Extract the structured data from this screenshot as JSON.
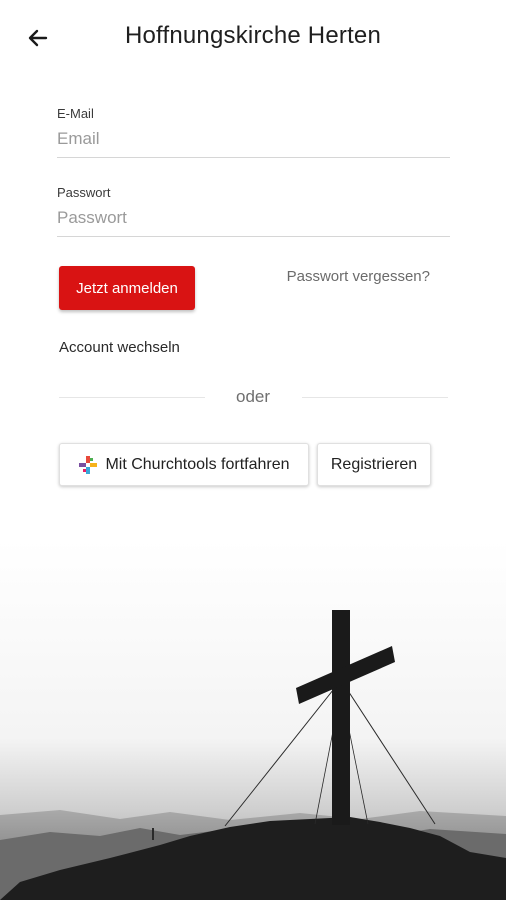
{
  "header": {
    "title": "Hoffnungskirche Herten",
    "back_icon": "arrow-left-icon"
  },
  "form": {
    "email": {
      "label": "E-Mail",
      "placeholder": "Email",
      "value": ""
    },
    "password": {
      "label": "Passwort",
      "placeholder": "Passwort",
      "value": ""
    }
  },
  "actions": {
    "login_label": "Jetzt anmelden",
    "forgot_label": "Passwort vergessen?",
    "switch_account_label": "Account wechseln",
    "divider_label": "oder",
    "churchtools_label": "Mit Churchtools fortfahren",
    "churchtools_icon": "churchtools-logo-icon",
    "register_label": "Registrieren"
  },
  "colors": {
    "primary": "#d91313",
    "text": "#222222",
    "muted": "#9a9a9a"
  },
  "image": {
    "icon": "cross-on-mountain-photo"
  }
}
